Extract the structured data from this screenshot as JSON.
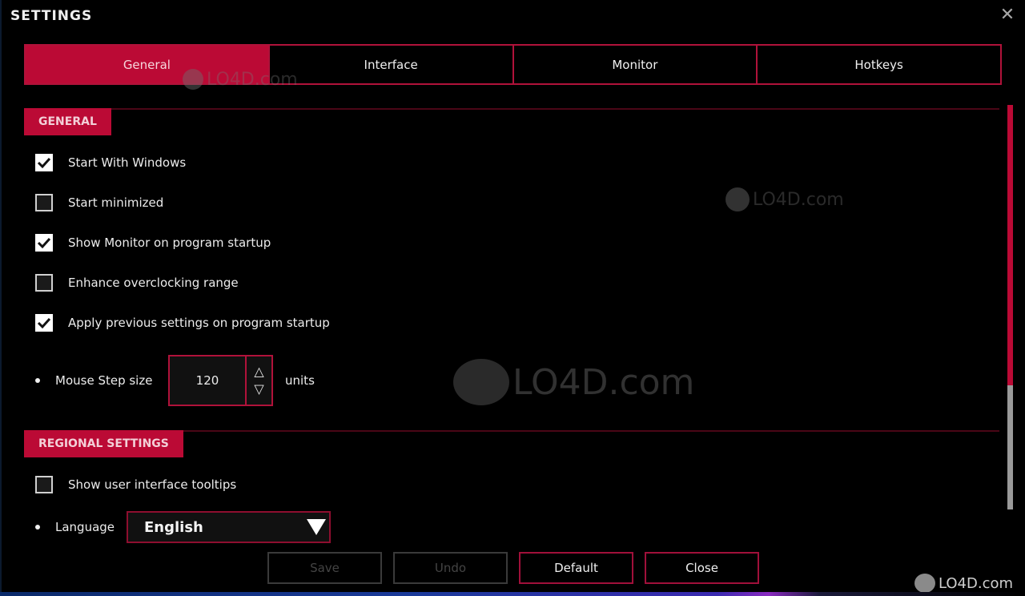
{
  "window": {
    "title": "SETTINGS",
    "close_icon": "close-x-icon"
  },
  "tabs": [
    {
      "label": "General",
      "active": true
    },
    {
      "label": "Interface",
      "active": false
    },
    {
      "label": "Monitor",
      "active": false
    },
    {
      "label": "Hotkeys",
      "active": false
    }
  ],
  "general_section": {
    "heading": "GENERAL",
    "options": [
      {
        "label": "Start With Windows",
        "checked": true
      },
      {
        "label": "Start minimized",
        "checked": false
      },
      {
        "label": "Show Monitor on program startup",
        "checked": true
      },
      {
        "label": "Enhance overclocking range",
        "checked": false
      },
      {
        "label": "Apply previous settings on program startup",
        "checked": true
      }
    ],
    "mouse_step": {
      "label": "Mouse Step size",
      "value": "120",
      "units": "units",
      "up_icon": "△",
      "down_icon": "▽"
    }
  },
  "regional_section": {
    "heading": "REGIONAL SETTINGS",
    "tooltips": {
      "label": "Show user interface tooltips",
      "checked": false
    },
    "language": {
      "label": "Language",
      "value": "English"
    }
  },
  "footer": {
    "save_label": "Save",
    "undo_label": "Undo",
    "default_label": "Default",
    "close_label": "Close"
  },
  "scrollbar": {
    "position_fraction": 0.0,
    "visible_fraction": 0.7
  },
  "watermark": {
    "text": "LO4D.com"
  },
  "colors": {
    "accent": "#bb0a35",
    "background": "#000000",
    "disabled": "#444444"
  }
}
